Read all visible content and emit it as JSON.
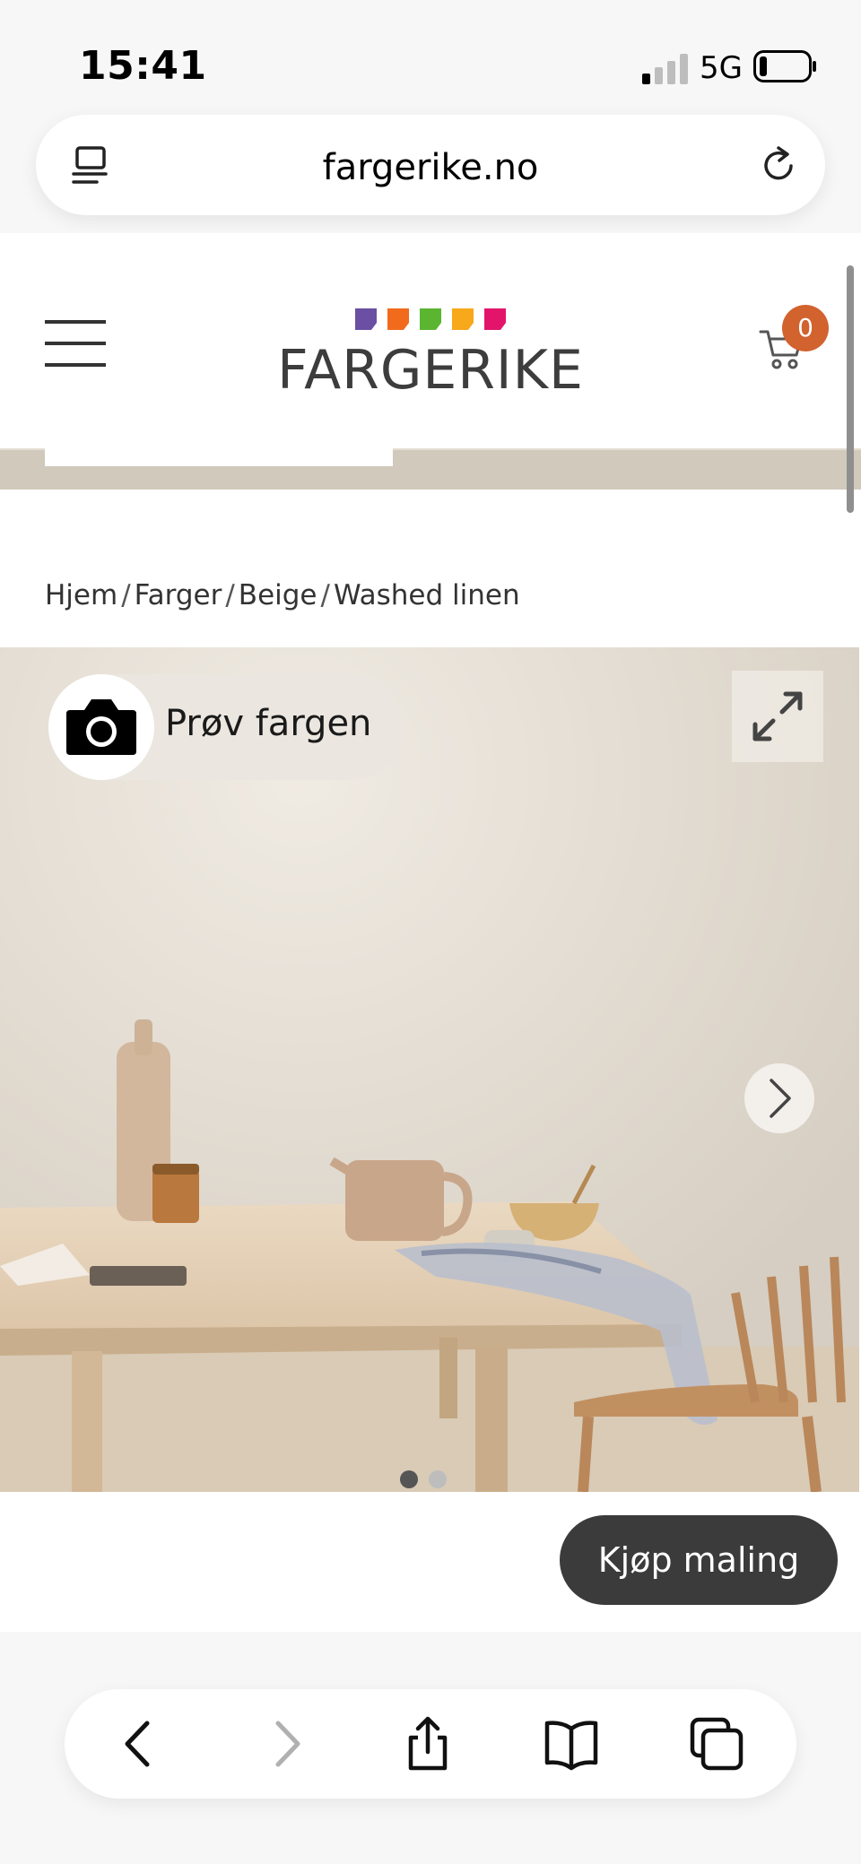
{
  "status_bar": {
    "time": "15:41",
    "network": "5G"
  },
  "browser": {
    "url": "fargerike.no"
  },
  "site": {
    "logo_text": "FARGERIKE",
    "logo_colors": [
      "#6a4fa3",
      "#f26b1d",
      "#5bb531",
      "#f7a81b",
      "#e2156b"
    ],
    "cart_count": "0",
    "accent_color": "#d2622e"
  },
  "breadcrumb": {
    "items": [
      "Hjem",
      "Farger",
      "Beige",
      "Washed linen"
    ],
    "separator": "/"
  },
  "hero": {
    "try_color_label": "Prøv fargen",
    "slide_count": 2,
    "active_slide": 1
  },
  "actions": {
    "buy_label": "Kjøp maling"
  },
  "toolbar": {
    "icons": [
      "back-icon",
      "forward-icon",
      "share-icon",
      "bookmarks-icon",
      "tabs-icon"
    ]
  }
}
